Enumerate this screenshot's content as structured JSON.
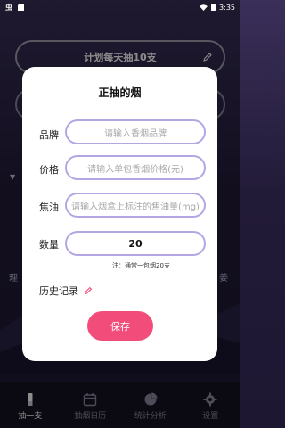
{
  "status_bar": {
    "left_glyph": "虫",
    "time": "3:35"
  },
  "background": {
    "plan_title": "计划每天抽10支",
    "left_side_text": "理",
    "right_side_text": "姜"
  },
  "dialog": {
    "title": "正抽的烟",
    "fields": [
      {
        "label": "品牌",
        "placeholder": "请输入香烟品牌",
        "value": ""
      },
      {
        "label": "价格",
        "placeholder": "请输入单包香烟价格(元)",
        "value": ""
      },
      {
        "label": "焦油",
        "placeholder": "请输入烟盒上标注的焦油量(mg)",
        "value": ""
      },
      {
        "label": "数量",
        "placeholder": "",
        "value": "20"
      }
    ],
    "hint": "注：通常一包烟20支",
    "history_label": "历史记录",
    "save_label": "保存"
  },
  "bottom_nav": {
    "items": [
      {
        "label": "抽一支",
        "icon": "cigarette-icon",
        "active": true
      },
      {
        "label": "抽烟日历",
        "icon": "calendar-icon",
        "active": false
      },
      {
        "label": "统计分析",
        "icon": "pie-chart-icon",
        "active": false
      },
      {
        "label": "设置",
        "icon": "gear-icon",
        "active": false
      }
    ]
  },
  "colors": {
    "accent": "#f24d7a",
    "input_border": "#b4a6e3",
    "background_top": "#3a2f59"
  }
}
